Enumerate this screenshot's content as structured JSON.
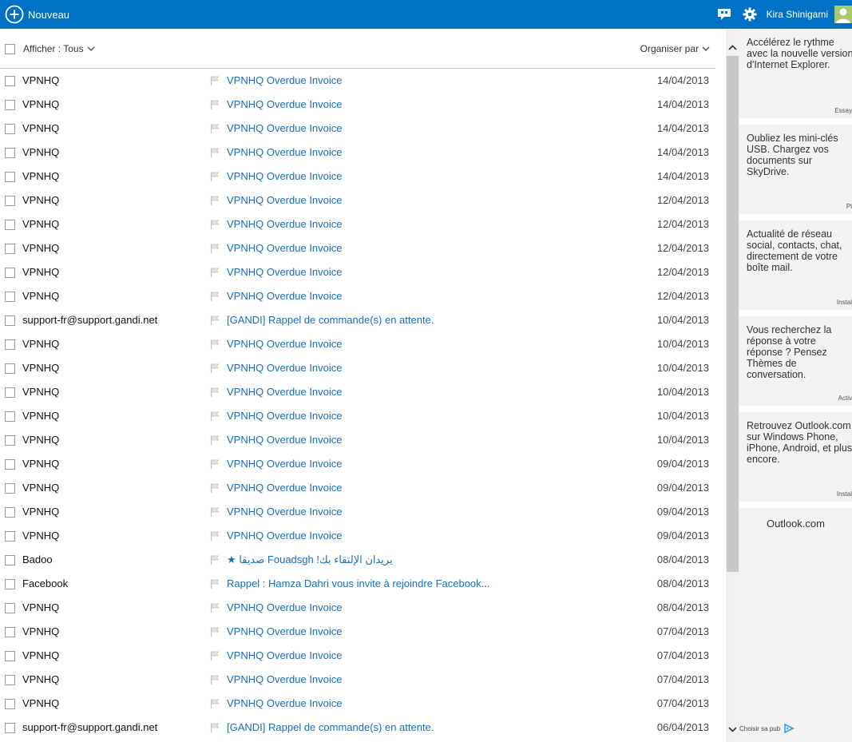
{
  "topbar": {
    "new_label": "Nouveau",
    "username": "Kira Shinigami",
    "accent": "#0072c6"
  },
  "list_header": {
    "filter_label": "Afficher : Tous",
    "sort_label": "Organiser par"
  },
  "messages": [
    {
      "sender": "VPNHQ",
      "subject": "VPNHQ Overdue Invoice",
      "date": "14/04/2013"
    },
    {
      "sender": "VPNHQ",
      "subject": "VPNHQ Overdue Invoice",
      "date": "14/04/2013"
    },
    {
      "sender": "VPNHQ",
      "subject": "VPNHQ Overdue Invoice",
      "date": "14/04/2013"
    },
    {
      "sender": "VPNHQ",
      "subject": "VPNHQ Overdue Invoice",
      "date": "14/04/2013"
    },
    {
      "sender": "VPNHQ",
      "subject": "VPNHQ Overdue Invoice",
      "date": "14/04/2013"
    },
    {
      "sender": "VPNHQ",
      "subject": "VPNHQ Overdue Invoice",
      "date": "12/04/2013"
    },
    {
      "sender": "VPNHQ",
      "subject": "VPNHQ Overdue Invoice",
      "date": "12/04/2013"
    },
    {
      "sender": "VPNHQ",
      "subject": "VPNHQ Overdue Invoice",
      "date": "12/04/2013"
    },
    {
      "sender": "VPNHQ",
      "subject": "VPNHQ Overdue Invoice",
      "date": "12/04/2013"
    },
    {
      "sender": "VPNHQ",
      "subject": "VPNHQ Overdue Invoice",
      "date": "12/04/2013"
    },
    {
      "sender": "support-fr@support.gandi.net",
      "subject": "[GANDI] Rappel de commande(s) en attente.",
      "date": "10/04/2013"
    },
    {
      "sender": "VPNHQ",
      "subject": "VPNHQ Overdue Invoice",
      "date": "10/04/2013"
    },
    {
      "sender": "VPNHQ",
      "subject": "VPNHQ Overdue Invoice",
      "date": "10/04/2013"
    },
    {
      "sender": "VPNHQ",
      "subject": "VPNHQ Overdue Invoice",
      "date": "10/04/2013"
    },
    {
      "sender": "VPNHQ",
      "subject": "VPNHQ Overdue Invoice",
      "date": "10/04/2013"
    },
    {
      "sender": "VPNHQ",
      "subject": "VPNHQ Overdue Invoice",
      "date": "10/04/2013"
    },
    {
      "sender": "VPNHQ",
      "subject": "VPNHQ Overdue Invoice",
      "date": "09/04/2013"
    },
    {
      "sender": "VPNHQ",
      "subject": "VPNHQ Overdue Invoice",
      "date": "09/04/2013"
    },
    {
      "sender": "VPNHQ",
      "subject": "VPNHQ Overdue Invoice",
      "date": "09/04/2013"
    },
    {
      "sender": "VPNHQ",
      "subject": "VPNHQ Overdue Invoice",
      "date": "09/04/2013"
    },
    {
      "sender": "Badoo",
      "subject": "★ صديقا Fouadsgh !يريدان الإلتقاء بك",
      "date": "08/04/2013"
    },
    {
      "sender": "Facebook",
      "subject": "Rappel : Hamza Dahri vous invite à rejoindre Facebook...",
      "date": "08/04/2013"
    },
    {
      "sender": "VPNHQ",
      "subject": "VPNHQ Overdue Invoice",
      "date": "08/04/2013"
    },
    {
      "sender": "VPNHQ",
      "subject": "VPNHQ Overdue Invoice",
      "date": "07/04/2013"
    },
    {
      "sender": "VPNHQ",
      "subject": "VPNHQ Overdue Invoice",
      "date": "07/04/2013"
    },
    {
      "sender": "VPNHQ",
      "subject": "VPNHQ Overdue Invoice",
      "date": "07/04/2013"
    },
    {
      "sender": "VPNHQ",
      "subject": "VPNHQ Overdue Invoice",
      "date": "07/04/2013"
    },
    {
      "sender": "support-fr@support.gandi.net",
      "subject": "[GANDI] Rappel de commande(s) en attente.",
      "date": "06/04/2013"
    }
  ],
  "ads": [
    {
      "text": "Accélérez le rythme avec la nouvelle version d'Internet Explorer.",
      "cta": "Essay"
    },
    {
      "text": "Oubliez les mini-clés USB. Chargez vos documents sur SkyDrive.",
      "cta": "Pl"
    },
    {
      "text": "Actualité de réseau social, contacts, chat, directement de votre boîte mail.",
      "cta": "Instal"
    },
    {
      "text": "Vous recherchez la réponse à votre réponse ? Pensez Thèmes de conversation.",
      "cta": "Activ"
    },
    {
      "text": "Retrouvez Outlook.com sur Windows Phone, iPhone, Android, et plus encore.",
      "cta": "Instal"
    }
  ],
  "adpanel": {
    "brand": "Outlook.com",
    "choose_label": "Choisir sa pub"
  },
  "colors": {
    "subject_link": "#1a6fb6",
    "scroll_thumb": "#c8c8c8",
    "ad_background": "#f2f2f2"
  }
}
